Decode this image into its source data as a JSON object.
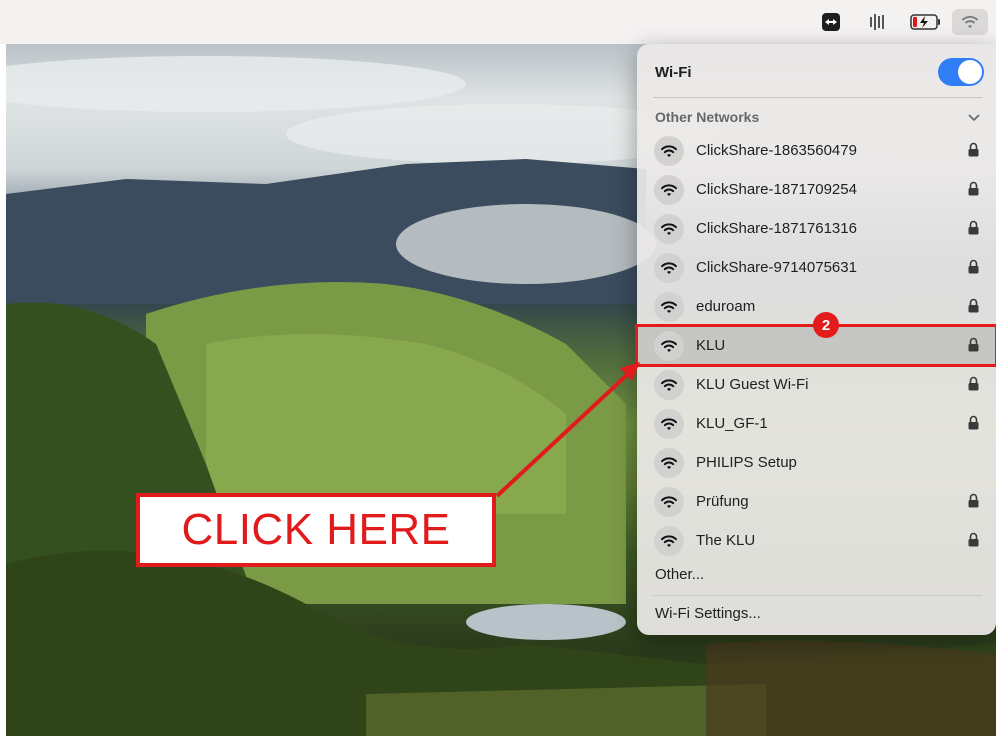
{
  "menubar": {
    "icons": [
      "teamviewer-icon",
      "audio-meter-icon",
      "battery-charging-icon",
      "wifi-icon"
    ]
  },
  "wifi_panel": {
    "title": "Wi-Fi",
    "toggle_on": true,
    "section_label": "Other Networks",
    "networks": [
      {
        "name": "ClickShare-1863560479",
        "locked": true
      },
      {
        "name": "ClickShare-1871709254",
        "locked": true
      },
      {
        "name": "ClickShare-1871761316",
        "locked": true
      },
      {
        "name": "ClickShare-9714075631",
        "locked": true
      },
      {
        "name": "eduroam",
        "locked": true
      },
      {
        "name": "KLU",
        "locked": true,
        "highlighted": true
      },
      {
        "name": "KLU Guest Wi-Fi",
        "locked": true
      },
      {
        "name": "KLU_GF-1",
        "locked": true
      },
      {
        "name": "PHILIPS Setup",
        "locked": false
      },
      {
        "name": "Prüfung",
        "locked": true
      },
      {
        "name": "The KLU",
        "locked": true
      }
    ],
    "other_label": "Other...",
    "settings_label": "Wi-Fi Settings..."
  },
  "annotation": {
    "step_number": "2",
    "callout_text": "CLICK HERE",
    "accent_color": "#e11b1b"
  }
}
